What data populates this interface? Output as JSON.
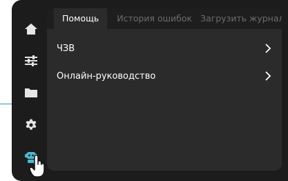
{
  "tabs": [
    {
      "label": "Помощь",
      "active": true
    },
    {
      "label": "История ошибок",
      "active": false
    },
    {
      "label": "Загрузить журнал",
      "active": false
    }
  ],
  "rows": [
    {
      "label": "ЧЗВ"
    },
    {
      "label": "Онлайн-руководство"
    }
  ],
  "sidebar": {
    "items": [
      {
        "icon": "home-icon"
      },
      {
        "icon": "sliders-icon"
      },
      {
        "icon": "folder-icon"
      },
      {
        "icon": "gear-icon"
      },
      {
        "icon": "robot-help-icon",
        "active": true
      }
    ]
  },
  "colors": {
    "accent": "#4ab8d0",
    "icon": "#e6e6e6",
    "inactive_tab": "#6c6c6c",
    "callout": "#2a9fb4"
  }
}
